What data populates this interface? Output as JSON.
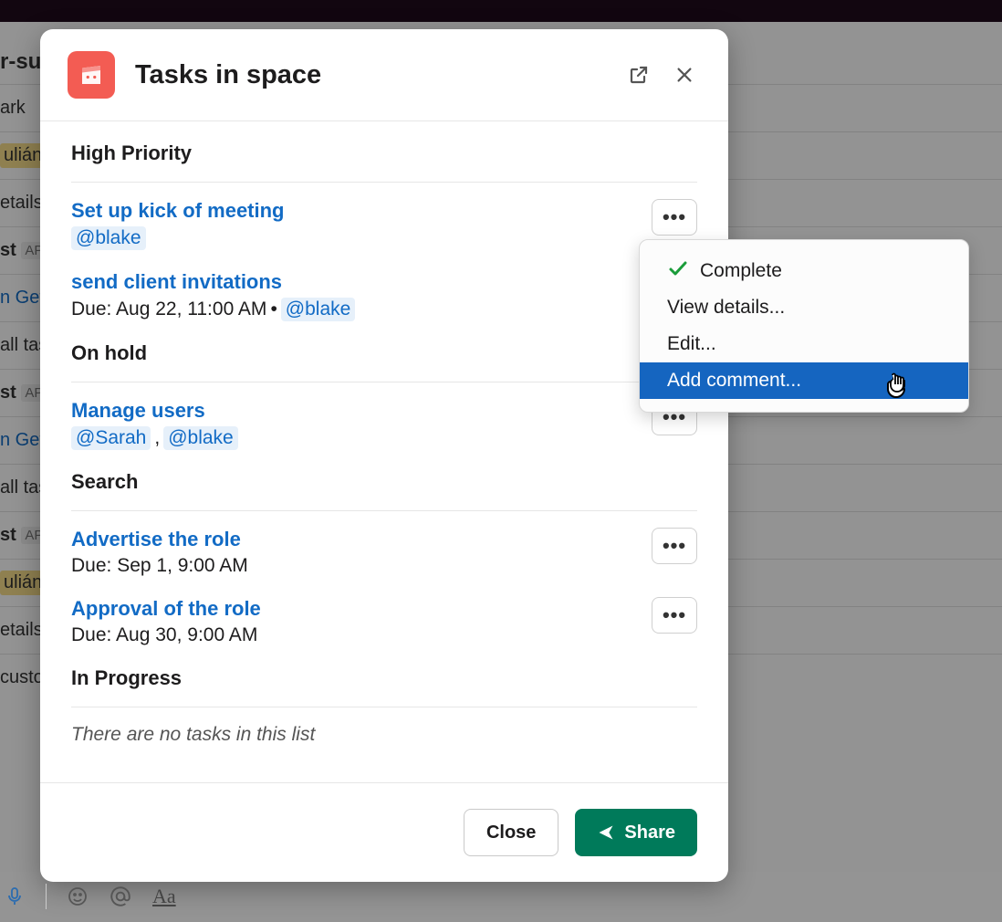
{
  "modal": {
    "title": "Tasks in space",
    "footer": {
      "close": "Close",
      "share": "Share"
    }
  },
  "sections": [
    {
      "title": "High Priority",
      "tasks": [
        {
          "title": "Set up kick of meeting",
          "due": null,
          "assignees": [
            "@blake"
          ],
          "showMore": true
        },
        {
          "title": "send client invitations",
          "due": "Due: Aug 22, 11:00 AM",
          "assignees": [
            "@blake"
          ],
          "showMore": false
        }
      ]
    },
    {
      "title": "On hold",
      "tasks": [
        {
          "title": "Manage users",
          "due": null,
          "assignees": [
            "@Sarah",
            "@blake"
          ],
          "showMore": true
        }
      ]
    },
    {
      "title": "Search",
      "tasks": [
        {
          "title": "Advertise the role",
          "due": "Due: Sep 1, 9:00 AM",
          "assignees": [],
          "showMore": true
        },
        {
          "title": "Approval of the role",
          "due": "Due: Aug 30, 9:00 AM",
          "assignees": [],
          "showMore": true
        }
      ]
    },
    {
      "title": "In Progress",
      "empty": "There are no tasks in this list",
      "tasks": []
    }
  ],
  "menu": {
    "items": [
      {
        "label": "Complete",
        "kind": "check"
      },
      {
        "label": "View details...",
        "kind": "plain"
      },
      {
        "label": "Edit...",
        "kind": "plain"
      },
      {
        "label": "Add comment...",
        "kind": "highlight"
      }
    ]
  },
  "background": {
    "heading": "r-su",
    "lines": [
      "ark",
      "ulián",
      "etails",
      "st",
      "n Get",
      "all tas",
      "st",
      "n Get",
      "all tas",
      "st",
      "ulián",
      "etails",
      "custo"
    ]
  }
}
